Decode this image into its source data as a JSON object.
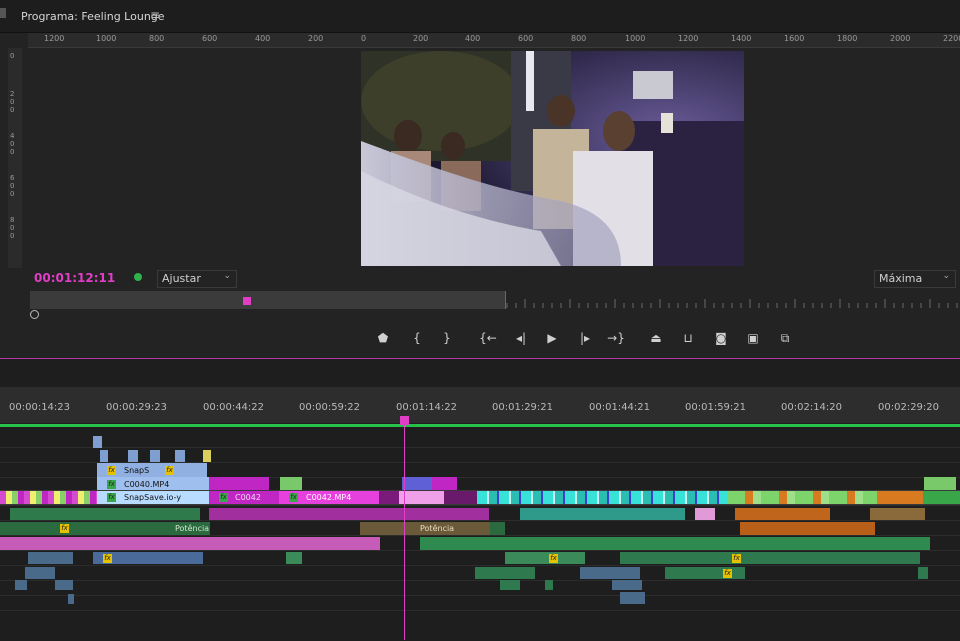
{
  "monitor": {
    "title": "Programa: Feeling Lounge",
    "menu_icon": "hamburger-icon",
    "ruler_h": [
      "1200",
      "1000",
      "800",
      "600",
      "400",
      "200",
      "0",
      "200",
      "400",
      "600",
      "800",
      "1000",
      "1200",
      "1400",
      "1600",
      "1800",
      "2000",
      "2200"
    ],
    "ruler_v": [
      "0",
      "2\n0\n0",
      "4\n0\n0",
      "6\n0\n0",
      "8\n0\n0"
    ],
    "timecode": "00:01:12:11",
    "fit": "Ajustar",
    "resolution": "Máxima",
    "controls": [
      "marker-icon",
      "in-point-icon",
      "out-point-icon",
      "go-to-in-icon",
      "step-back-icon",
      "play-icon",
      "step-forward-icon",
      "go-to-out-icon",
      "lift-icon",
      "extract-icon",
      "export-frame-icon",
      "compare-icon",
      "comparison-view-icon"
    ],
    "colors": {
      "accent": "#e13ec6",
      "dot": "#2fb24c"
    }
  },
  "timeline": {
    "ruler": [
      "00:00:14:23",
      "00:00:29:23",
      "00:00:44:22",
      "00:00:59:22",
      "00:01:14:22",
      "00:01:29:21",
      "00:01:44:21",
      "00:01:59:21",
      "00:02:14:20",
      "00:02:29:20"
    ],
    "clip_labels": {
      "snap1": "SnapS",
      "c0040": "C0040.MP4",
      "snapsave": "SnapSave.io-y",
      "c0042a": "C0042",
      "c0042b": "C0042.MP4",
      "pot1": "Potência",
      "pot2": "Potência"
    }
  }
}
